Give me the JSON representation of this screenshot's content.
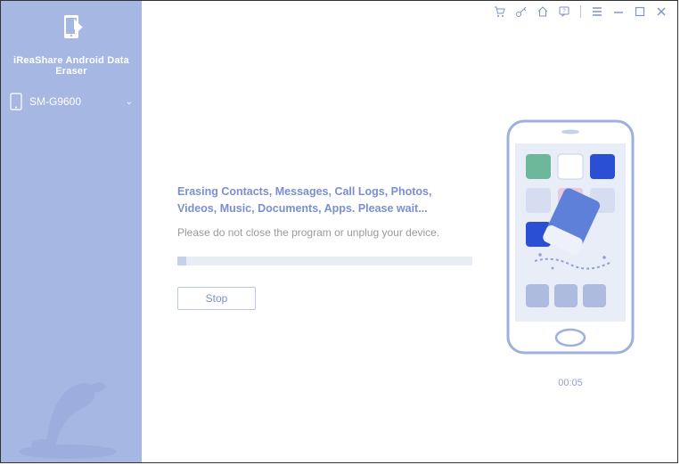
{
  "app": {
    "title": "iReaShare Android Data Eraser"
  },
  "sidebar": {
    "device": {
      "name": "SM-G9600"
    }
  },
  "titlebar": {
    "icons": [
      "cart",
      "key",
      "home",
      "feedback",
      "menu",
      "minimize",
      "maximize",
      "close"
    ]
  },
  "main": {
    "status_line": "Erasing Contacts, Messages, Call Logs, Photos, Videos, Music, Documents, Apps. Please wait...",
    "warning": "Please do not close the program or unplug your device.",
    "stop_label": "Stop",
    "progress_percent": 3,
    "timer": "00:05"
  }
}
